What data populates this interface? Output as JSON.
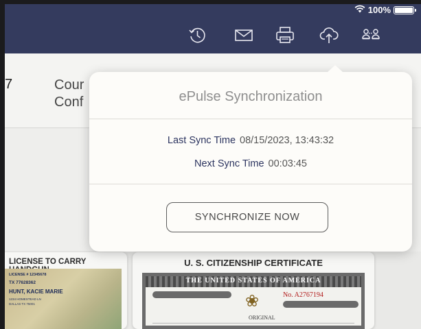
{
  "status_bar": {
    "battery": "100%",
    "battery_level": 1.0
  },
  "toolbar": {
    "icons": [
      "history-icon",
      "mail-icon",
      "printer-icon",
      "cloud-upload-icon",
      "users-link-icon"
    ]
  },
  "background_row": {
    "number": "7",
    "line1": "Cour",
    "line2": "Conf"
  },
  "popover": {
    "title": "ePulse Synchronization",
    "last_sync_label": "Last Sync Time",
    "last_sync_value": "08/15/2023, 13:43:32",
    "next_sync_label": "Next Sync Time",
    "next_sync_value": "00:03:45",
    "sync_button": "SYNCHRONIZE NOW"
  },
  "cards": {
    "license": {
      "title": "LICENSE TO CARRY HANDGUN",
      "license_no": "LICENSE # 12345678",
      "state_line": "TX 77628362",
      "name": "HUNT, KACIE MARIE",
      "address1": "1234 HOMESTEAD LN",
      "address2": "DALLAS TX 75001"
    },
    "certificate": {
      "title": "U. S. CITIZENSHIP CERTIFICATE",
      "banner": "THE UNITED STATES OF AMERICA",
      "number": "No. A2767194",
      "original": "ORIGINAL"
    }
  },
  "colors": {
    "header": "#343b5e",
    "label": "#2d3560",
    "popover_bg": "#fdfcf9"
  }
}
